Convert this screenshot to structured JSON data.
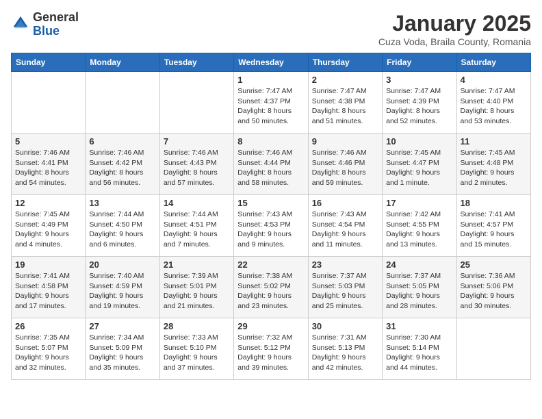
{
  "header": {
    "logo_general": "General",
    "logo_blue": "Blue",
    "title": "January 2025",
    "subtitle": "Cuza Voda, Braila County, Romania"
  },
  "weekdays": [
    "Sunday",
    "Monday",
    "Tuesday",
    "Wednesday",
    "Thursday",
    "Friday",
    "Saturday"
  ],
  "weeks": [
    [
      {
        "day": "",
        "info": ""
      },
      {
        "day": "",
        "info": ""
      },
      {
        "day": "",
        "info": ""
      },
      {
        "day": "1",
        "info": "Sunrise: 7:47 AM\nSunset: 4:37 PM\nDaylight: 8 hours\nand 50 minutes."
      },
      {
        "day": "2",
        "info": "Sunrise: 7:47 AM\nSunset: 4:38 PM\nDaylight: 8 hours\nand 51 minutes."
      },
      {
        "day": "3",
        "info": "Sunrise: 7:47 AM\nSunset: 4:39 PM\nDaylight: 8 hours\nand 52 minutes."
      },
      {
        "day": "4",
        "info": "Sunrise: 7:47 AM\nSunset: 4:40 PM\nDaylight: 8 hours\nand 53 minutes."
      }
    ],
    [
      {
        "day": "5",
        "info": "Sunrise: 7:46 AM\nSunset: 4:41 PM\nDaylight: 8 hours\nand 54 minutes."
      },
      {
        "day": "6",
        "info": "Sunrise: 7:46 AM\nSunset: 4:42 PM\nDaylight: 8 hours\nand 56 minutes."
      },
      {
        "day": "7",
        "info": "Sunrise: 7:46 AM\nSunset: 4:43 PM\nDaylight: 8 hours\nand 57 minutes."
      },
      {
        "day": "8",
        "info": "Sunrise: 7:46 AM\nSunset: 4:44 PM\nDaylight: 8 hours\nand 58 minutes."
      },
      {
        "day": "9",
        "info": "Sunrise: 7:46 AM\nSunset: 4:46 PM\nDaylight: 8 hours\nand 59 minutes."
      },
      {
        "day": "10",
        "info": "Sunrise: 7:45 AM\nSunset: 4:47 PM\nDaylight: 9 hours\nand 1 minute."
      },
      {
        "day": "11",
        "info": "Sunrise: 7:45 AM\nSunset: 4:48 PM\nDaylight: 9 hours\nand 2 minutes."
      }
    ],
    [
      {
        "day": "12",
        "info": "Sunrise: 7:45 AM\nSunset: 4:49 PM\nDaylight: 9 hours\nand 4 minutes."
      },
      {
        "day": "13",
        "info": "Sunrise: 7:44 AM\nSunset: 4:50 PM\nDaylight: 9 hours\nand 6 minutes."
      },
      {
        "day": "14",
        "info": "Sunrise: 7:44 AM\nSunset: 4:51 PM\nDaylight: 9 hours\nand 7 minutes."
      },
      {
        "day": "15",
        "info": "Sunrise: 7:43 AM\nSunset: 4:53 PM\nDaylight: 9 hours\nand 9 minutes."
      },
      {
        "day": "16",
        "info": "Sunrise: 7:43 AM\nSunset: 4:54 PM\nDaylight: 9 hours\nand 11 minutes."
      },
      {
        "day": "17",
        "info": "Sunrise: 7:42 AM\nSunset: 4:55 PM\nDaylight: 9 hours\nand 13 minutes."
      },
      {
        "day": "18",
        "info": "Sunrise: 7:41 AM\nSunset: 4:57 PM\nDaylight: 9 hours\nand 15 minutes."
      }
    ],
    [
      {
        "day": "19",
        "info": "Sunrise: 7:41 AM\nSunset: 4:58 PM\nDaylight: 9 hours\nand 17 minutes."
      },
      {
        "day": "20",
        "info": "Sunrise: 7:40 AM\nSunset: 4:59 PM\nDaylight: 9 hours\nand 19 minutes."
      },
      {
        "day": "21",
        "info": "Sunrise: 7:39 AM\nSunset: 5:01 PM\nDaylight: 9 hours\nand 21 minutes."
      },
      {
        "day": "22",
        "info": "Sunrise: 7:38 AM\nSunset: 5:02 PM\nDaylight: 9 hours\nand 23 minutes."
      },
      {
        "day": "23",
        "info": "Sunrise: 7:37 AM\nSunset: 5:03 PM\nDaylight: 9 hours\nand 25 minutes."
      },
      {
        "day": "24",
        "info": "Sunrise: 7:37 AM\nSunset: 5:05 PM\nDaylight: 9 hours\nand 28 minutes."
      },
      {
        "day": "25",
        "info": "Sunrise: 7:36 AM\nSunset: 5:06 PM\nDaylight: 9 hours\nand 30 minutes."
      }
    ],
    [
      {
        "day": "26",
        "info": "Sunrise: 7:35 AM\nSunset: 5:07 PM\nDaylight: 9 hours\nand 32 minutes."
      },
      {
        "day": "27",
        "info": "Sunrise: 7:34 AM\nSunset: 5:09 PM\nDaylight: 9 hours\nand 35 minutes."
      },
      {
        "day": "28",
        "info": "Sunrise: 7:33 AM\nSunset: 5:10 PM\nDaylight: 9 hours\nand 37 minutes."
      },
      {
        "day": "29",
        "info": "Sunrise: 7:32 AM\nSunset: 5:12 PM\nDaylight: 9 hours\nand 39 minutes."
      },
      {
        "day": "30",
        "info": "Sunrise: 7:31 AM\nSunset: 5:13 PM\nDaylight: 9 hours\nand 42 minutes."
      },
      {
        "day": "31",
        "info": "Sunrise: 7:30 AM\nSunset: 5:14 PM\nDaylight: 9 hours\nand 44 minutes."
      },
      {
        "day": "",
        "info": ""
      }
    ]
  ]
}
